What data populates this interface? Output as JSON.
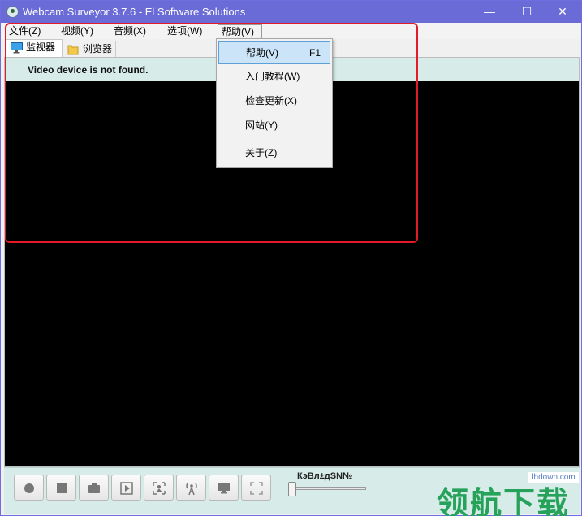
{
  "window": {
    "title": "Webcam Surveyor 3.7.6 - El Software Solutions",
    "minimize_glyph": "—",
    "maximize_glyph": "☐",
    "close_glyph": "✕"
  },
  "menubar": {
    "items": [
      {
        "label": "文件(Z)"
      },
      {
        "label": "视频(Y)"
      },
      {
        "label": "音频(X)"
      },
      {
        "label": "选项(W)"
      },
      {
        "label": "帮助(V)",
        "active": true
      }
    ]
  },
  "tabs": [
    {
      "label": "监视器",
      "selected": true,
      "icon": "monitor-icon"
    },
    {
      "label": "浏览器",
      "selected": false,
      "icon": "folder-icon"
    }
  ],
  "monitor": {
    "status": "Video device is not found."
  },
  "help_menu": {
    "items": [
      {
        "label": "帮助(V)",
        "shortcut": "F1",
        "highlighted": true
      },
      {
        "label": "入门教程(W)"
      },
      {
        "label": "检查更新(X)"
      },
      {
        "label": "网站(Y)"
      },
      {
        "label": "关于(Z)"
      }
    ]
  },
  "toolbar": {
    "buttons": [
      {
        "icon": "record-icon"
      },
      {
        "icon": "stop-icon"
      },
      {
        "icon": "snapshot-icon"
      },
      {
        "icon": "playback-icon"
      },
      {
        "icon": "motion-detect-icon"
      },
      {
        "icon": "broadcast-icon"
      },
      {
        "icon": "display-icon"
      },
      {
        "icon": "fullscreen-icon"
      }
    ],
    "slider_label": "КэВл±дSN№",
    "slider_level": 0.0
  },
  "watermark": {
    "url": "lhdown.com",
    "text": "领航下载"
  },
  "colors": {
    "titlebar": "#6b6bd8",
    "annotation": "#e41a2a",
    "strip": "#d7ece9",
    "watermark": "#27a25a"
  }
}
